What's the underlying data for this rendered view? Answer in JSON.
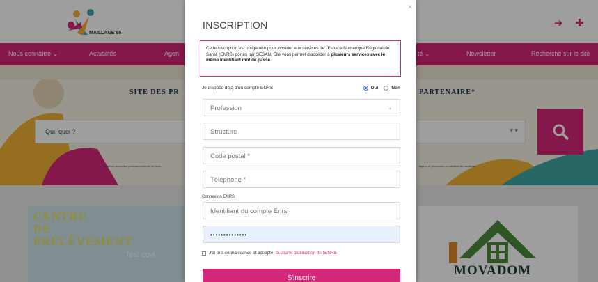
{
  "site": {
    "logo_text": "MAILLAGE 95",
    "nav": [
      {
        "label": "Nous connaître ⌄"
      },
      {
        "label": "Actualités"
      },
      {
        "label": "Agen"
      },
      {
        "label": "té ⌄"
      },
      {
        "label": "Newsletter"
      },
      {
        "label": "Recherche sur le site"
      }
    ],
    "hero": {
      "title_left": "SITE DES PR",
      "title_right": "PARTENAIRE*",
      "search_placeholder": "Qui, quoi ?",
      "search_dropdown": "▾ ▾",
      "note_left": "* Ayant un accès aux professionnels du territoire",
      "note_right": "tagées et personnes en situation de handicap"
    },
    "card_left": {
      "title_lines": [
        "CENTRE",
        "DE",
        "PRÉLÈVEMENT"
      ],
      "subtitle": "Test covi"
    },
    "card_right": {
      "brand": "MOVADOM"
    },
    "colors": {
      "brand": "#d6287a",
      "nav_bg": "#d6287a"
    }
  },
  "modal": {
    "title": "INSCRIPTION",
    "close": "×",
    "info": {
      "text_1": "Cette inscription est obligatoire pour accéder aux services de l'Espace Numérique Régional de Santé (ENRS) portés par SESAN. Elle vous permet d'accéder à ",
      "text_bold": "plusieurs services avec le même identifiant mot de passe",
      "text_2": "."
    },
    "enrs_question": "Je dispose déjà d'un compte ENRS",
    "radio_yes": "Oui",
    "radio_no": "Non",
    "fields": {
      "profession": "Profession",
      "structure": "Structure",
      "postal_code": "Code postal *",
      "phone": "Téléphone *",
      "connection_label": "Connexion ENRS",
      "account_id": "Identifiant du compte Enrs",
      "password": "••••••••••••••"
    },
    "accept_text": "J'ai pris connaissance et accepte",
    "accept_link": "la charte d'utilisation de l'ENRS",
    "submit": "S'inscrire"
  }
}
